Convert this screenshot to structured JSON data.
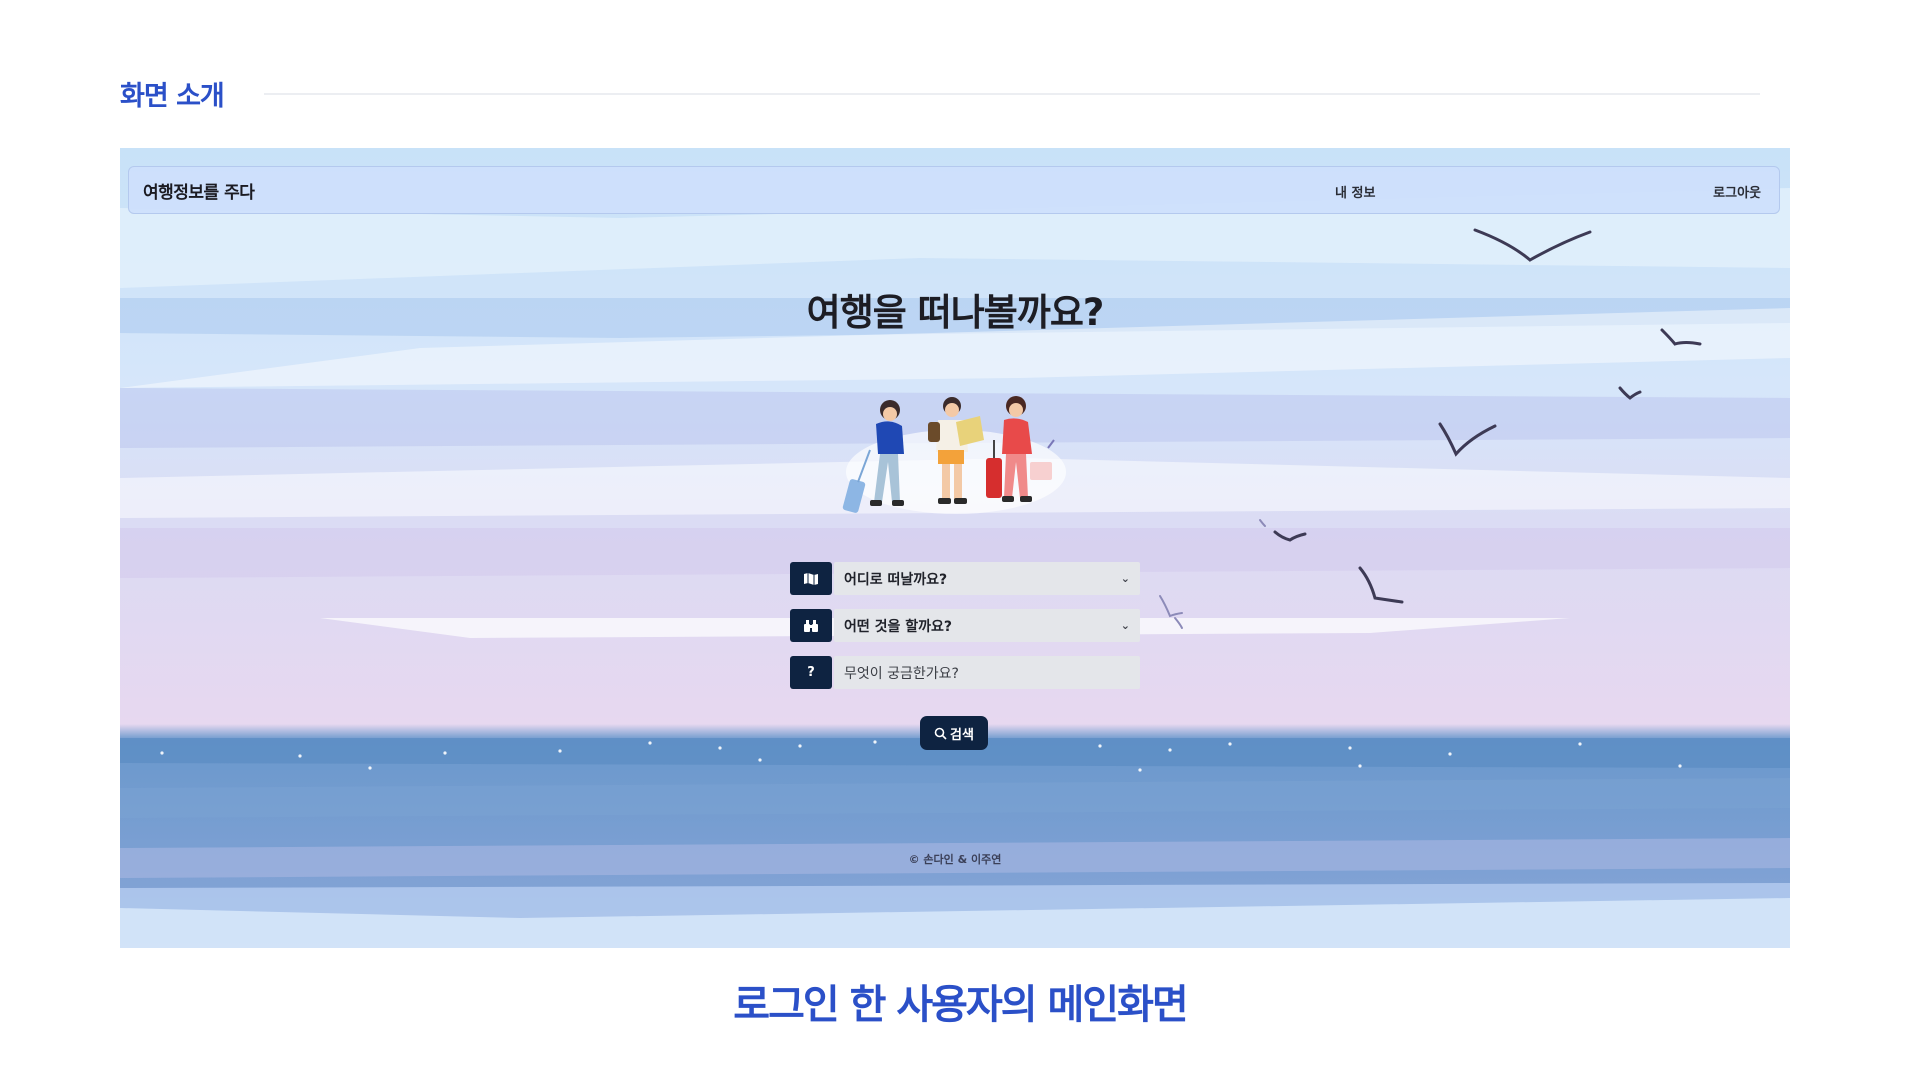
{
  "section": {
    "title": "화면 소개"
  },
  "app": {
    "brand": "여행정보를 주다",
    "nav": {
      "my_info": "내 정보",
      "logout": "로그아웃"
    },
    "hero_title": "여행을 떠나볼까요?",
    "form": {
      "destination": {
        "value": "어디로 떠날까요?",
        "icon": "map-icon"
      },
      "activity": {
        "value": "어떤 것을 할까요?",
        "icon": "binoculars-icon"
      },
      "question": {
        "placeholder": "무엇이 궁금한가요?",
        "icon_text": "?"
      }
    },
    "search_button": "검색",
    "footer": "© 손다인 & 이주연"
  },
  "caption": "로그인 한 사용자의 메인화면",
  "colors": {
    "accent": "#2b50c8",
    "navy": "#0e2341",
    "navbar": "#cddffc"
  }
}
